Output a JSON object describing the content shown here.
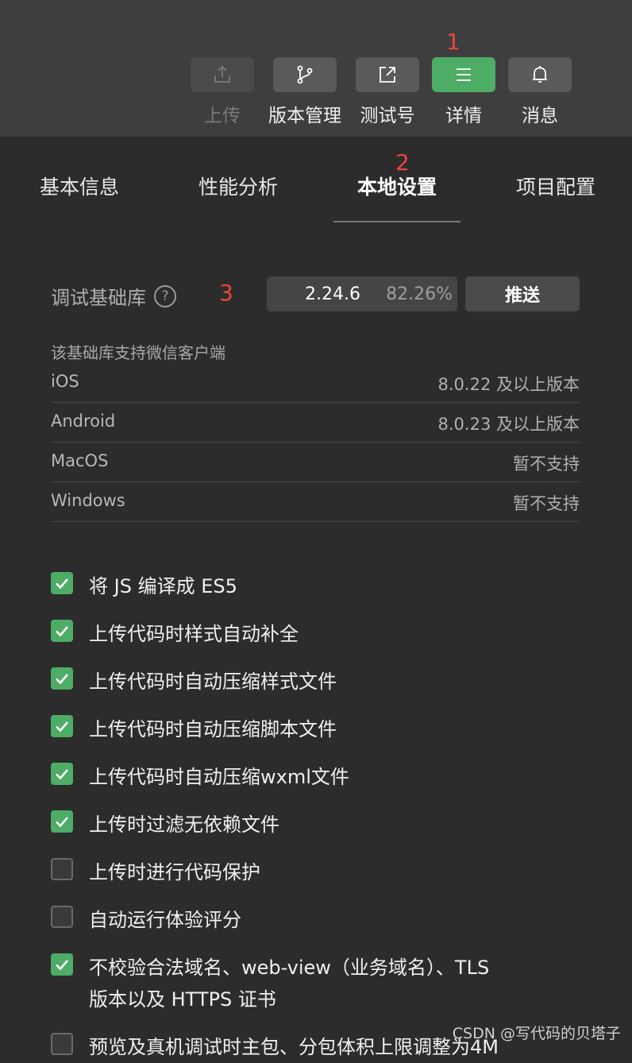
{
  "toolbar": {
    "buttons": [
      {
        "label": "上传",
        "icon": "upload-icon",
        "state": "disabled"
      },
      {
        "label": "版本管理",
        "icon": "git-branch-icon",
        "state": "normal"
      },
      {
        "label": "测试号",
        "icon": "external-link-icon",
        "state": "normal"
      },
      {
        "label": "详情",
        "icon": "menu-icon",
        "state": "active"
      },
      {
        "label": "消息",
        "icon": "bell-icon",
        "state": "normal"
      }
    ],
    "accent_color": "#4dac66"
  },
  "annotations": [
    "1",
    "2",
    "3"
  ],
  "tabs": [
    {
      "label": "基本信息",
      "active": false
    },
    {
      "label": "性能分析",
      "active": false
    },
    {
      "label": "本地设置",
      "active": true
    },
    {
      "label": "项目配置",
      "active": false
    }
  ],
  "library": {
    "label": "调试基础库",
    "help_icon": "?",
    "version": "2.24.6",
    "percent": "82.26%",
    "push_label": "推送"
  },
  "support": {
    "title": "该基础库支持微信客户端",
    "rows": [
      {
        "os": "iOS",
        "version": "8.0.22 及以上版本"
      },
      {
        "os": "Android",
        "version": "8.0.23 及以上版本"
      },
      {
        "os": "MacOS",
        "version": "暂不支持"
      },
      {
        "os": "Windows",
        "version": "暂不支持"
      }
    ]
  },
  "options": [
    {
      "label": "将 JS 编译成 ES5",
      "checked": true
    },
    {
      "label": "上传代码时样式自动补全",
      "checked": true
    },
    {
      "label": "上传代码时自动压缩样式文件",
      "checked": true
    },
    {
      "label": "上传代码时自动压缩脚本文件",
      "checked": true
    },
    {
      "label": "上传代码时自动压缩wxml文件",
      "checked": true
    },
    {
      "label": "上传时过滤无依赖文件",
      "checked": true
    },
    {
      "label": "上传时进行代码保护",
      "checked": false
    },
    {
      "label": "自动运行体验评分",
      "checked": false
    },
    {
      "label": "不校验合法域名、web-view（业务域名）、TLS",
      "label2": "版本以及 HTTPS 证书",
      "checked": true
    },
    {
      "label": "预览及真机调试时主包、分包体积上限调整为4M",
      "checked": false
    }
  ],
  "watermark": "CSDN @写代码的贝塔子"
}
